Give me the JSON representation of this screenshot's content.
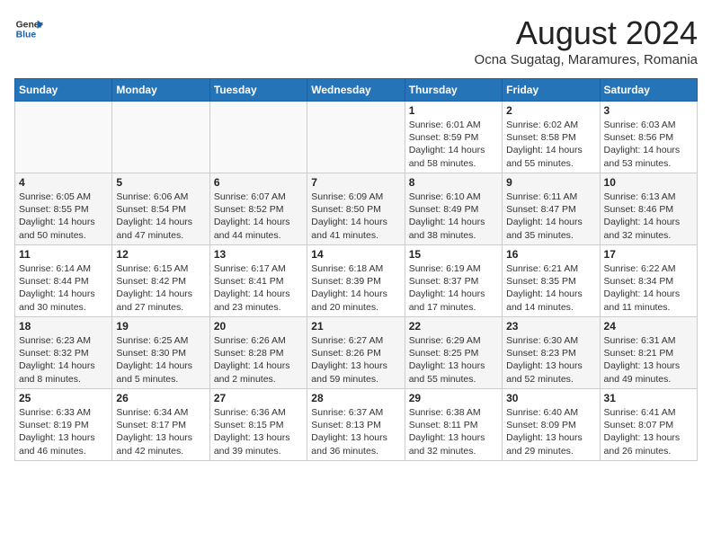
{
  "header": {
    "logo_general": "General",
    "logo_blue": "Blue",
    "month_year": "August 2024",
    "location": "Ocna Sugatag, Maramures, Romania"
  },
  "weekdays": [
    "Sunday",
    "Monday",
    "Tuesday",
    "Wednesday",
    "Thursday",
    "Friday",
    "Saturday"
  ],
  "weeks": [
    [
      {
        "day": "",
        "info": ""
      },
      {
        "day": "",
        "info": ""
      },
      {
        "day": "",
        "info": ""
      },
      {
        "day": "",
        "info": ""
      },
      {
        "day": "1",
        "info": "Sunrise: 6:01 AM\nSunset: 8:59 PM\nDaylight: 14 hours\nand 58 minutes."
      },
      {
        "day": "2",
        "info": "Sunrise: 6:02 AM\nSunset: 8:58 PM\nDaylight: 14 hours\nand 55 minutes."
      },
      {
        "day": "3",
        "info": "Sunrise: 6:03 AM\nSunset: 8:56 PM\nDaylight: 14 hours\nand 53 minutes."
      }
    ],
    [
      {
        "day": "4",
        "info": "Sunrise: 6:05 AM\nSunset: 8:55 PM\nDaylight: 14 hours\nand 50 minutes."
      },
      {
        "day": "5",
        "info": "Sunrise: 6:06 AM\nSunset: 8:54 PM\nDaylight: 14 hours\nand 47 minutes."
      },
      {
        "day": "6",
        "info": "Sunrise: 6:07 AM\nSunset: 8:52 PM\nDaylight: 14 hours\nand 44 minutes."
      },
      {
        "day": "7",
        "info": "Sunrise: 6:09 AM\nSunset: 8:50 PM\nDaylight: 14 hours\nand 41 minutes."
      },
      {
        "day": "8",
        "info": "Sunrise: 6:10 AM\nSunset: 8:49 PM\nDaylight: 14 hours\nand 38 minutes."
      },
      {
        "day": "9",
        "info": "Sunrise: 6:11 AM\nSunset: 8:47 PM\nDaylight: 14 hours\nand 35 minutes."
      },
      {
        "day": "10",
        "info": "Sunrise: 6:13 AM\nSunset: 8:46 PM\nDaylight: 14 hours\nand 32 minutes."
      }
    ],
    [
      {
        "day": "11",
        "info": "Sunrise: 6:14 AM\nSunset: 8:44 PM\nDaylight: 14 hours\nand 30 minutes."
      },
      {
        "day": "12",
        "info": "Sunrise: 6:15 AM\nSunset: 8:42 PM\nDaylight: 14 hours\nand 27 minutes."
      },
      {
        "day": "13",
        "info": "Sunrise: 6:17 AM\nSunset: 8:41 PM\nDaylight: 14 hours\nand 23 minutes."
      },
      {
        "day": "14",
        "info": "Sunrise: 6:18 AM\nSunset: 8:39 PM\nDaylight: 14 hours\nand 20 minutes."
      },
      {
        "day": "15",
        "info": "Sunrise: 6:19 AM\nSunset: 8:37 PM\nDaylight: 14 hours\nand 17 minutes."
      },
      {
        "day": "16",
        "info": "Sunrise: 6:21 AM\nSunset: 8:35 PM\nDaylight: 14 hours\nand 14 minutes."
      },
      {
        "day": "17",
        "info": "Sunrise: 6:22 AM\nSunset: 8:34 PM\nDaylight: 14 hours\nand 11 minutes."
      }
    ],
    [
      {
        "day": "18",
        "info": "Sunrise: 6:23 AM\nSunset: 8:32 PM\nDaylight: 14 hours\nand 8 minutes."
      },
      {
        "day": "19",
        "info": "Sunrise: 6:25 AM\nSunset: 8:30 PM\nDaylight: 14 hours\nand 5 minutes."
      },
      {
        "day": "20",
        "info": "Sunrise: 6:26 AM\nSunset: 8:28 PM\nDaylight: 14 hours\nand 2 minutes."
      },
      {
        "day": "21",
        "info": "Sunrise: 6:27 AM\nSunset: 8:26 PM\nDaylight: 13 hours\nand 59 minutes."
      },
      {
        "day": "22",
        "info": "Sunrise: 6:29 AM\nSunset: 8:25 PM\nDaylight: 13 hours\nand 55 minutes."
      },
      {
        "day": "23",
        "info": "Sunrise: 6:30 AM\nSunset: 8:23 PM\nDaylight: 13 hours\nand 52 minutes."
      },
      {
        "day": "24",
        "info": "Sunrise: 6:31 AM\nSunset: 8:21 PM\nDaylight: 13 hours\nand 49 minutes."
      }
    ],
    [
      {
        "day": "25",
        "info": "Sunrise: 6:33 AM\nSunset: 8:19 PM\nDaylight: 13 hours\nand 46 minutes."
      },
      {
        "day": "26",
        "info": "Sunrise: 6:34 AM\nSunset: 8:17 PM\nDaylight: 13 hours\nand 42 minutes."
      },
      {
        "day": "27",
        "info": "Sunrise: 6:36 AM\nSunset: 8:15 PM\nDaylight: 13 hours\nand 39 minutes."
      },
      {
        "day": "28",
        "info": "Sunrise: 6:37 AM\nSunset: 8:13 PM\nDaylight: 13 hours\nand 36 minutes."
      },
      {
        "day": "29",
        "info": "Sunrise: 6:38 AM\nSunset: 8:11 PM\nDaylight: 13 hours\nand 32 minutes."
      },
      {
        "day": "30",
        "info": "Sunrise: 6:40 AM\nSunset: 8:09 PM\nDaylight: 13 hours\nand 29 minutes."
      },
      {
        "day": "31",
        "info": "Sunrise: 6:41 AM\nSunset: 8:07 PM\nDaylight: 13 hours\nand 26 minutes."
      }
    ]
  ]
}
